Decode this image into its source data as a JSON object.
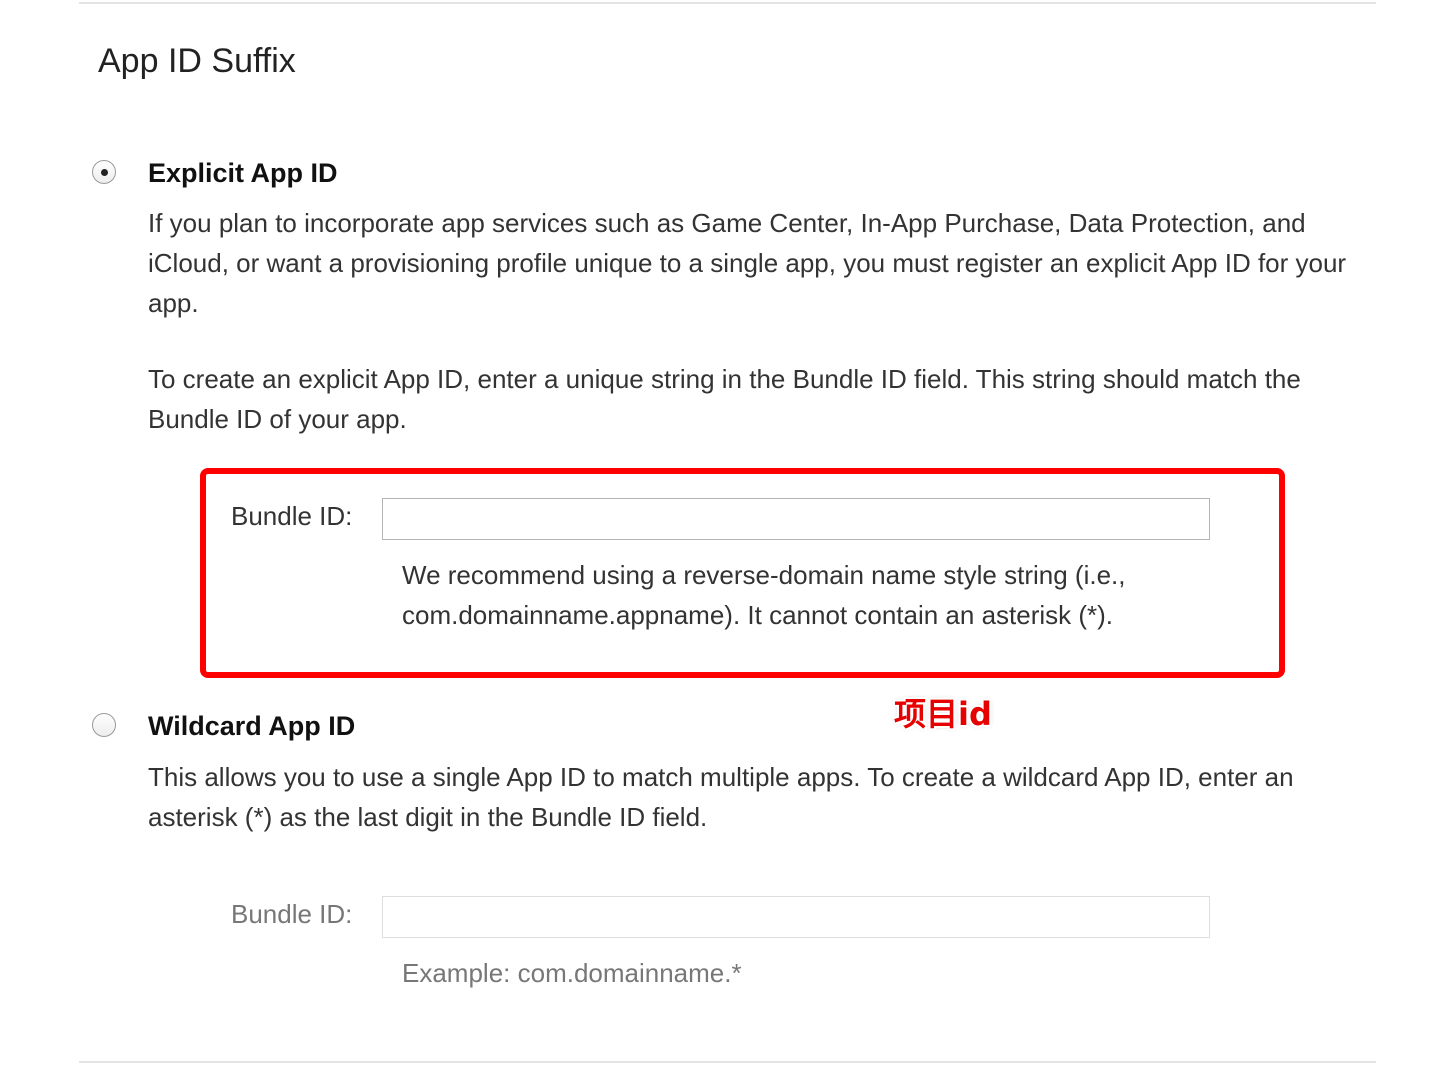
{
  "section": {
    "title": "App ID Suffix"
  },
  "explicit": {
    "title": "Explicit App ID",
    "selected": true,
    "description_1": "If you plan to incorporate app services such as Game Center, In-App Purchase, Data Protection, and iCloud, or want a provisioning profile unique to a single app, you must register an explicit App ID for your app.",
    "description_2": "To create an explicit App ID, enter a unique string in the Bundle ID field. This string should match the Bundle ID of your app.",
    "bundle_label": "Bundle ID:",
    "bundle_value": "",
    "bundle_hint": "We recommend using a reverse-domain name style string (i.e., com.domainname.appname). It cannot contain an asterisk (*)."
  },
  "wildcard": {
    "title": "Wildcard App ID",
    "selected": false,
    "description": "This allows you to use a single App ID to match multiple apps. To create a wildcard App ID, enter an asterisk (*) as the last digit in the Bundle ID field.",
    "bundle_label": "Bundle ID:",
    "bundle_value": "",
    "bundle_hint": "Example: com.domainname.*"
  },
  "annotation": {
    "text": "项目id",
    "color": "#ff0000"
  }
}
